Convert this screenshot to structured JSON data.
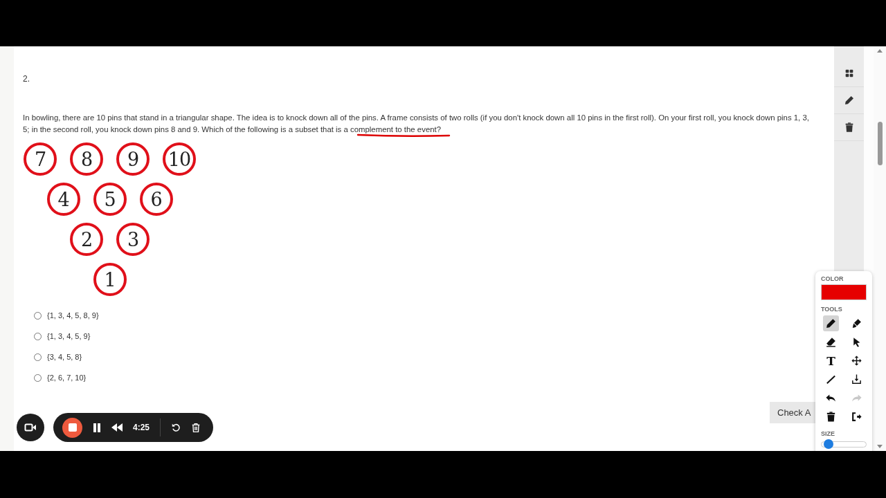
{
  "question": {
    "number": "2.",
    "lines": [
      "In bowling, there are 10 pins that stand in a triangular shape. The idea is to knock down all of the pins. A frame consists of two rolls (if you don't knock down all 10 pins in the first roll). On your first roll, you knock down pins 1, 3,",
      "5; in the second roll, you knock down pins 8 and 9. Which of the following is a subset that is a complement to the event?"
    ],
    "pin_rows": [
      [
        "7",
        "8",
        "9",
        "10"
      ],
      [
        "4",
        "5",
        "6"
      ],
      [
        "2",
        "3"
      ],
      [
        "1"
      ]
    ],
    "options": [
      {
        "label": "{1, 3, 4, 5, 8, 9}",
        "selected": false
      },
      {
        "label": "{1, 3, 4, 5, 9}",
        "selected": false
      },
      {
        "label": "{3, 4, 5, 8}",
        "selected": false
      },
      {
        "label": "{2, 6, 7, 10}",
        "selected": false
      }
    ]
  },
  "check_button": "Check A",
  "side_tools": [
    {
      "kind": "grid"
    },
    {
      "kind": "pencil"
    },
    {
      "kind": "trash"
    }
  ],
  "draw_panel": {
    "color_label": "COLOR",
    "color": "#e60000",
    "tools_label": "TOOLS",
    "tools": [
      {
        "kind": "pencil",
        "selected": true,
        "disabled": false
      },
      {
        "kind": "marker",
        "selected": false,
        "disabled": false
      },
      {
        "kind": "eraser",
        "selected": false,
        "disabled": false
      },
      {
        "kind": "pointer",
        "selected": false,
        "disabled": false
      },
      {
        "kind": "text",
        "glyph": "T",
        "selected": false,
        "disabled": false
      },
      {
        "kind": "move",
        "selected": false,
        "disabled": false
      },
      {
        "kind": "line",
        "selected": false,
        "disabled": false
      },
      {
        "kind": "download",
        "selected": false,
        "disabled": false
      },
      {
        "kind": "undo",
        "selected": false,
        "disabled": false
      },
      {
        "kind": "redo",
        "selected": false,
        "disabled": true
      },
      {
        "kind": "trash",
        "selected": false,
        "disabled": false
      },
      {
        "kind": "exit",
        "selected": false,
        "disabled": false
      }
    ],
    "size_label": "SIZE",
    "size": {
      "level": 0.15
    }
  },
  "recorder": {
    "time": "4:25"
  }
}
